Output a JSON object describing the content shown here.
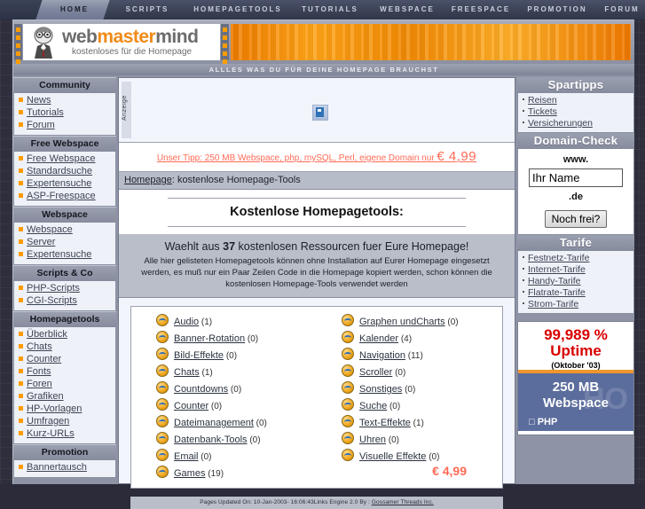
{
  "nav_tabs": [
    {
      "label": "HOME",
      "active": true
    },
    {
      "label": "SCRIPTS",
      "active": false
    },
    {
      "label": "HOMEPAGETOOLS",
      "active": false
    },
    {
      "label": "TUTORIALS",
      "active": false
    },
    {
      "label": "WEBSPACE",
      "active": false
    },
    {
      "label": "FREESPACE",
      "active": false
    },
    {
      "label": "PROMOTION",
      "active": false
    },
    {
      "label": "FORUM",
      "active": false
    }
  ],
  "header": {
    "logo_text_1": "web",
    "logo_text_2": "master",
    "logo_text_3": "mind",
    "logo_subtitle": "kostenloses für die Homepage",
    "tagline": "ALLLES WAS DU FÜR DEINE HOMEPAGE BRAUCHST"
  },
  "sidebar_left": [
    {
      "title": "Community",
      "items": [
        "News",
        "Tutorials",
        "Forum"
      ]
    },
    {
      "title": "Free Webspace",
      "items": [
        "Free Webspace",
        "Standardsuche",
        "Expertensuche",
        "ASP-Freespace"
      ]
    },
    {
      "title": "Webspace",
      "items": [
        "Webspace",
        "Server",
        "Expertensuche"
      ]
    },
    {
      "title": "Scripts & Co",
      "items": [
        "PHP-Scripts",
        "CGI-Scripts"
      ]
    },
    {
      "title": "Homepagetools",
      "items": [
        "Überblick",
        "Chats",
        "Counter",
        "Fonts",
        "Foren",
        "Grafiken",
        "HP-Vorlagen",
        "Umfragen",
        "Kurz-URLs"
      ]
    },
    {
      "title": "Promotion",
      "items": [
        "Bannertausch"
      ]
    }
  ],
  "sidebar_right": {
    "spartipps": {
      "title": "Spartipps",
      "items": [
        "Reisen",
        "Tickets",
        "Versicherungen"
      ]
    },
    "domain_check": {
      "title": "Domain-Check",
      "prefix": "www.",
      "input_value": "Ihr Name",
      "input_placeholder": "Ihr Name",
      "suffix": ".de",
      "button_label": "Noch frei?"
    },
    "tarife": {
      "title": "Tarife",
      "items": [
        "Festnetz-Tarife",
        "Internet-Tarife",
        "Handy-Tarife",
        "Flatrate-Tarife",
        "Strom-Tarife"
      ]
    },
    "uptime_ad": {
      "percent": "99,989 %",
      "word": "Uptime",
      "period": "(Oktober '03)",
      "space_line1": "250 MB",
      "space_line2": "Webspace",
      "feature": "PHP",
      "ghost": "HO"
    }
  },
  "main": {
    "ad_label": "Anzeige",
    "broken_image_icon": "broken-image-icon",
    "tip_text": "Unser Tipp: 250 MB Webspace, php, mySQL, Perl, eigene Domain nur ",
    "tip_price": "€ 4,99",
    "breadcrumb_link": "Homepage",
    "breadcrumb_rest": ": kostenlose Homepage-Tools",
    "page_title": "Kostenlose Homepagetools:",
    "intro_line1_a": "Waehlt aus ",
    "intro_count": "37",
    "intro_line1_b": " kostenlosen Ressourcen fuer Eure Homepage!",
    "intro_line2": "Alle hier gelisteten Homepagetools können ohne Installation auf Eurer Homepage eingesetzt werden, es muß nur ein Paar Zeilen Code in die Homepage kopiert werden, schon können die kostenlosen Homepage-Tools verwendet werden",
    "categories_left": [
      {
        "label": "Audio",
        "count": "(1)"
      },
      {
        "label": "Banner-Rotation",
        "count": "(0)"
      },
      {
        "label": "Bild-Effekte",
        "count": "(0)"
      },
      {
        "label": "Chats",
        "count": "(1)"
      },
      {
        "label": "Countdowns",
        "count": "(0)"
      },
      {
        "label": "Counter",
        "count": "(0)"
      },
      {
        "label": "Dateimanagement",
        "count": "(0)"
      },
      {
        "label": "Datenbank-Tools",
        "count": "(0)"
      },
      {
        "label": "Email",
        "count": "(0)"
      },
      {
        "label": "Games",
        "count": "(19)"
      }
    ],
    "categories_right": [
      {
        "label": "Graphen undCharts",
        "count": "(0)"
      },
      {
        "label": "Kalender",
        "count": "(4)"
      },
      {
        "label": "Navigation",
        "count": "(11)"
      },
      {
        "label": "Scroller",
        "count": "(0)"
      },
      {
        "label": "Sonstiges",
        "count": "(0)"
      },
      {
        "label": "Suche",
        "count": "(0)"
      },
      {
        "label": "Text-Effekte",
        "count": "(1)"
      },
      {
        "label": "Uhren",
        "count": "(0)"
      },
      {
        "label": "Visuelle Effekte",
        "count": "(0)"
      }
    ],
    "footer_text": "Pages Updated On: 10-Jan-2003- 16:06:43Links Engine 2.0 By : ",
    "footer_link": "Gossamer Threads Inc.",
    "bottom_price": "€ 4,99"
  },
  "colors": {
    "accent_orange": "#ff9c00",
    "link_red": "#ff6a55",
    "uptime_red": "#d90000",
    "panel_blue": "#5b6d9c"
  }
}
